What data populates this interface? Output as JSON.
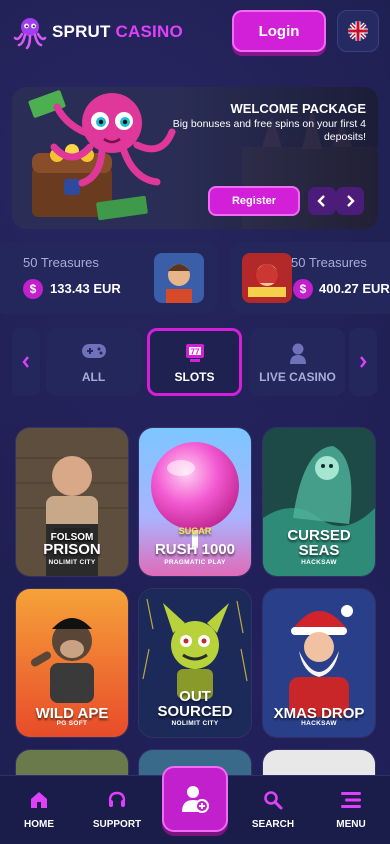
{
  "header": {
    "brand_part1": "SPRUT ",
    "brand_part2": "CASINO",
    "login_label": "Login",
    "language_icon": "uk-flag-icon"
  },
  "banner": {
    "title": "WELCOME PACKAGE",
    "subtitle": "Big bonuses and free spins on your first 4 deposits!",
    "register_label": "Register",
    "prev_icon": "chevron-left-icon",
    "next_icon": "chevron-right-icon"
  },
  "ticker": [
    {
      "game": "50 Treasures",
      "amount": "133.43 EUR",
      "currency_symbol": "$"
    },
    {
      "game": "50 Treasures",
      "amount": "400.27 EUR",
      "currency_symbol": "$"
    }
  ],
  "categories": {
    "prev_icon": "chevron-left-icon",
    "next_icon": "chevron-right-icon",
    "tabs": [
      {
        "label": "ALL",
        "icon": "gamepad-icon",
        "active": false
      },
      {
        "label": "SLOTS",
        "icon": "slot-machine-icon",
        "active": true
      },
      {
        "label": "LIVE CASINO",
        "icon": "dealer-icon",
        "active": false
      }
    ]
  },
  "games": [
    {
      "title_line1": "FOLSOM",
      "title_line2": "PRISON",
      "provider": "NOLIMIT CITY"
    },
    {
      "title_line1": "SUGAR",
      "title_line2": "RUSH 1000",
      "provider": "PRAGMATIC PLAY"
    },
    {
      "title_line1": "CURSED",
      "title_line2": "SEAS",
      "provider": "HACKSAW"
    },
    {
      "title_line1": "",
      "title_line2": "WILD APE",
      "provider": "PG SOFT"
    },
    {
      "title_line1": "OUT",
      "title_line2": "SOURCED",
      "provider": "NOLIMIT CITY"
    },
    {
      "title_line1": "",
      "title_line2": "XMAS DROP",
      "provider": "HACKSAW"
    }
  ],
  "bottom_nav": {
    "home": "HOME",
    "support": "SUPPORT",
    "search": "SEARCH",
    "menu": "MENU",
    "center_icon": "user-plus-icon"
  },
  "colors": {
    "background": "#1b1e4d",
    "accent": "#d21fd8",
    "card": "#23275b"
  }
}
